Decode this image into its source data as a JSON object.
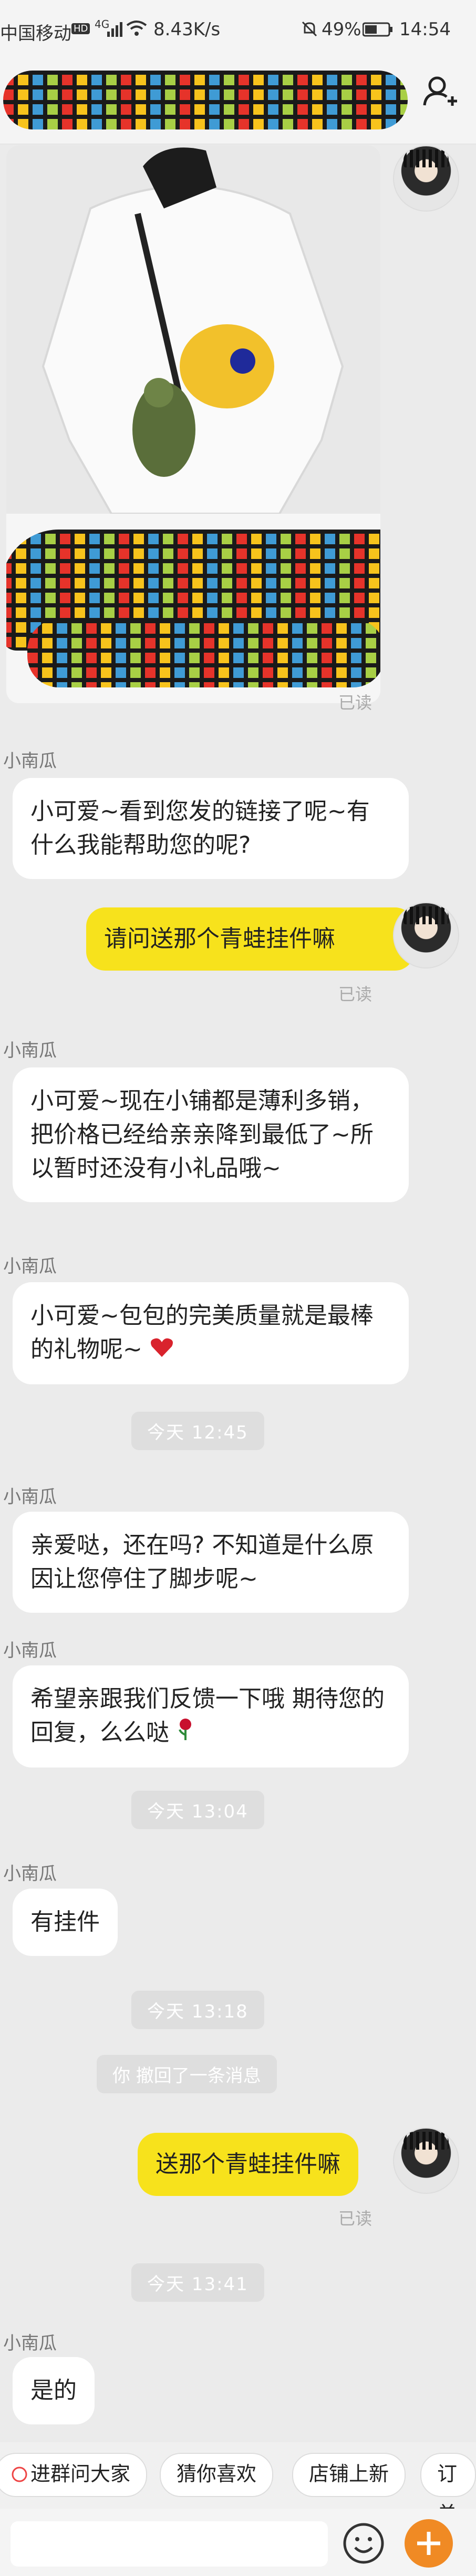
{
  "status_bar": {
    "carrier": "中国移动",
    "network_badge": "HD",
    "network_type": "4G",
    "speed": "8.43K/s",
    "battery_percent": "49%",
    "time": "14:54",
    "icons": [
      "signal-icon",
      "wifi-icon",
      "mute-icon",
      "battery-icon"
    ]
  },
  "header": {
    "profile_icon": "user-icon"
  },
  "messages": {
    "read_label": "已读",
    "m1": {
      "sender": "小南瓜",
      "text": "小可爱~看到您发的链接了呢~有什么我能帮助您的呢?"
    },
    "m2": {
      "text": "请问送那个青蛙挂件嘛"
    },
    "m3": {
      "sender": "小南瓜",
      "text": "小可爱~现在小铺都是薄利多销，把价格已经给亲亲降到最低了~所以暂时还没有小礼品哦~"
    },
    "m4": {
      "sender": "小南瓜",
      "text": "小可爱~包包的完美质量就是最棒的礼物呢~"
    },
    "t1": "今天 12:45",
    "m5": {
      "sender": "小南瓜",
      "text": "亲爱哒，还在吗? 不知道是什么原因让您停住了脚步呢~"
    },
    "m6": {
      "sender": "小南瓜",
      "text": "希望亲跟我们反馈一下哦 期待您的回复，么么哒"
    },
    "t2": "今天 13:04",
    "m7": {
      "sender": "小南瓜",
      "text": "有挂件"
    },
    "t3": "今天 13:18",
    "recall": "你 撤回了一条消息",
    "m8": {
      "text": "送那个青蛙挂件嘛"
    },
    "t4": "今天 13:41",
    "m9": {
      "sender": "小南瓜",
      "text": "是的"
    }
  },
  "quick_replies": [
    "进群问大家",
    "猜你喜欢",
    "店铺上新",
    "订单"
  ],
  "input": {
    "placeholder": ""
  },
  "colors": {
    "self_bubble": "#f7e21c",
    "peer_bubble": "#ffffff",
    "background": "#ebebeb"
  }
}
